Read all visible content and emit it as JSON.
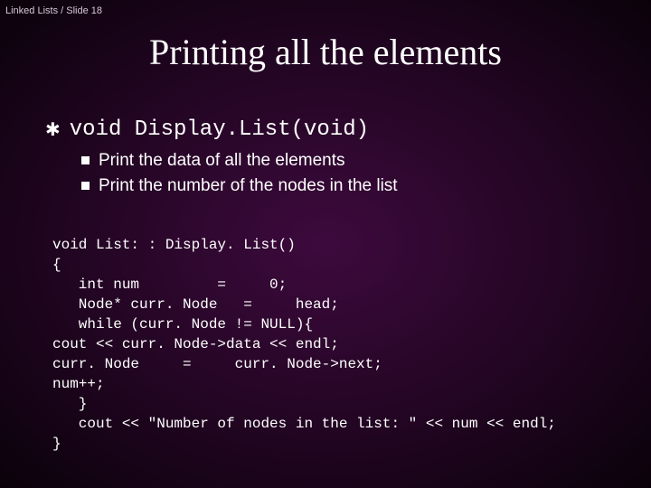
{
  "breadcrumb": "Linked Lists / Slide 18",
  "title": "Printing all the elements",
  "outline": {
    "l1": "void Display.List(void)",
    "l2a": "Print the data of all the elements",
    "l2b": "Print the number of the nodes in the list"
  },
  "code": "void List: : Display. List()\n{\n   int num         =     0;\n   Node* curr. Node   =     head;\n   while (curr. Node != NULL){\ncout << curr. Node->data << endl;\ncurr. Node     =     curr. Node->next;\nnum++;\n   }\n   cout << \"Number of nodes in the list: \" << num << endl;\n}"
}
